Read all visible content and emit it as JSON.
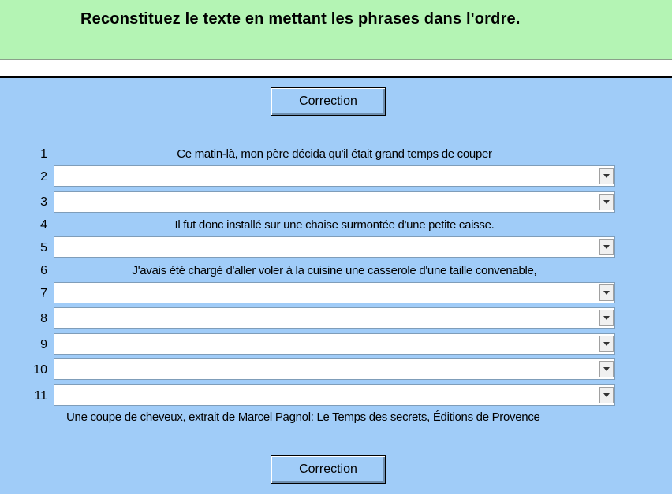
{
  "header": {
    "title": "Reconstituez le texte en mettant les phrases dans l'ordre."
  },
  "buttons": {
    "correction_top": "Correction",
    "correction_bottom": "Correction"
  },
  "rows": [
    {
      "number": "1",
      "type": "text",
      "text": "Ce matin-là, mon père décida qu'il était grand temps de couper"
    },
    {
      "number": "2",
      "type": "select",
      "value": ""
    },
    {
      "number": "3",
      "type": "select",
      "value": ""
    },
    {
      "number": "4",
      "type": "text",
      "text": "Il fut donc installé sur une chaise surmontée d'une petite caisse."
    },
    {
      "number": "5",
      "type": "select",
      "value": ""
    },
    {
      "number": "6",
      "type": "text",
      "text": "J'avais été chargé d'aller voler à la cuisine une casserole d'une taille convenable,"
    },
    {
      "number": "7",
      "type": "select",
      "value": ""
    },
    {
      "number": "8",
      "type": "select",
      "value": ""
    },
    {
      "number": "9",
      "type": "select",
      "value": ""
    },
    {
      "number": "10",
      "type": "select",
      "value": ""
    },
    {
      "number": "11",
      "type": "select",
      "value": ""
    }
  ],
  "source": "Une coupe de cheveux, extrait de Marcel Pagnol: Le Temps des secrets, Éditions de Provence"
}
